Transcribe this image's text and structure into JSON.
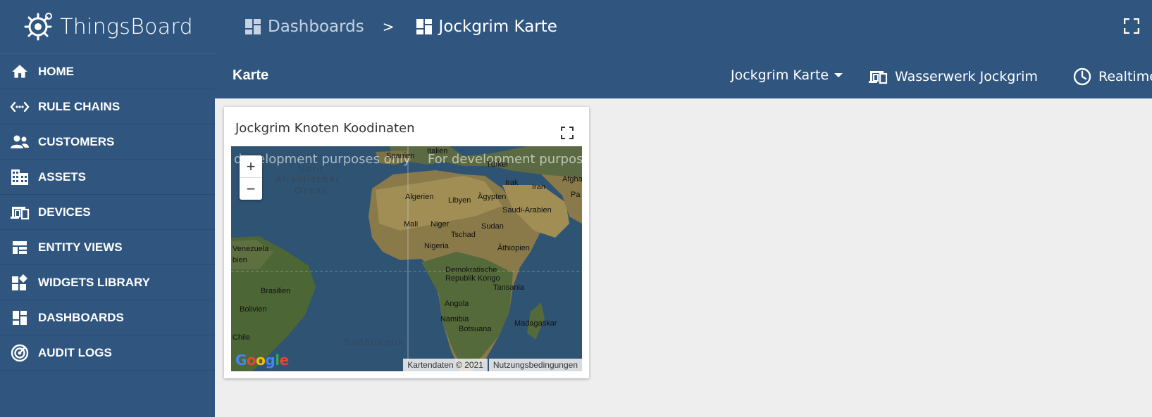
{
  "app": {
    "name": "ThingsBoard"
  },
  "sidebar": {
    "items": [
      {
        "label": "HOME",
        "icon": "home-icon"
      },
      {
        "label": "RULE CHAINS",
        "icon": "rule-chains-icon"
      },
      {
        "label": "CUSTOMERS",
        "icon": "customers-icon"
      },
      {
        "label": "ASSETS",
        "icon": "assets-icon"
      },
      {
        "label": "DEVICES",
        "icon": "devices-icon"
      },
      {
        "label": "ENTITY VIEWS",
        "icon": "entity-views-icon"
      },
      {
        "label": "WIDGETS LIBRARY",
        "icon": "widgets-library-icon"
      },
      {
        "label": "DASHBOARDS",
        "icon": "dashboards-icon"
      },
      {
        "label": "AUDIT LOGS",
        "icon": "audit-logs-icon"
      }
    ]
  },
  "breadcrumb": {
    "parent": "Dashboards",
    "separator": ">",
    "current": "Jockgrim Karte"
  },
  "toolbar": {
    "title": "Karte",
    "state_select": "Jockgrim Karte",
    "entity": "Wasserwerk Jockgrim",
    "timewindow": "Realtime"
  },
  "widget": {
    "title": "Jockgrim Knoten Koodinaten",
    "map": {
      "dev_text_left": "development purposes only",
      "dev_text_right": "For development purposes",
      "zoom_in": "+",
      "zoom_out": "−",
      "labels": {
        "spanien": "Spanien",
        "italien": "Italien",
        "turkei": "Türkei",
        "irak": "Irak",
        "iran": "Iran",
        "afgha": "Afgha",
        "pa": "Pa",
        "nord": "Nord",
        "atlantischer": "Atlantischer",
        "ozean": "Ozean",
        "algerien": "Algerien",
        "libyen": "Libyen",
        "agypten": "Ägypten",
        "saudi": "Saudi-Arabien",
        "mali": "Mali",
        "niger": "Niger",
        "tschad": "Tschad",
        "sudan": "Sudan",
        "nigeria": "Nigeria",
        "athiopien": "Äthiopien",
        "venezuela": "Venezuela",
        "bien": "bien",
        "demokratische": "Demokratische",
        "kongo": "Republik Kongo",
        "tansania": "Tansania",
        "brasilien": "Brasilien",
        "angola": "Angola",
        "bolivien": "Bolivien",
        "namibia": "Namibia",
        "botsuana": "Botsuana",
        "madagaskar": "Madagaskar",
        "chile": "Chile",
        "sudatlantik": "Südatlantik"
      },
      "google": "Google",
      "attribution": "Kartendaten © 2021",
      "terms": "Nutzungsbedingungen"
    }
  },
  "colors": {
    "primary": "#305680",
    "background": "#eeeeee"
  }
}
